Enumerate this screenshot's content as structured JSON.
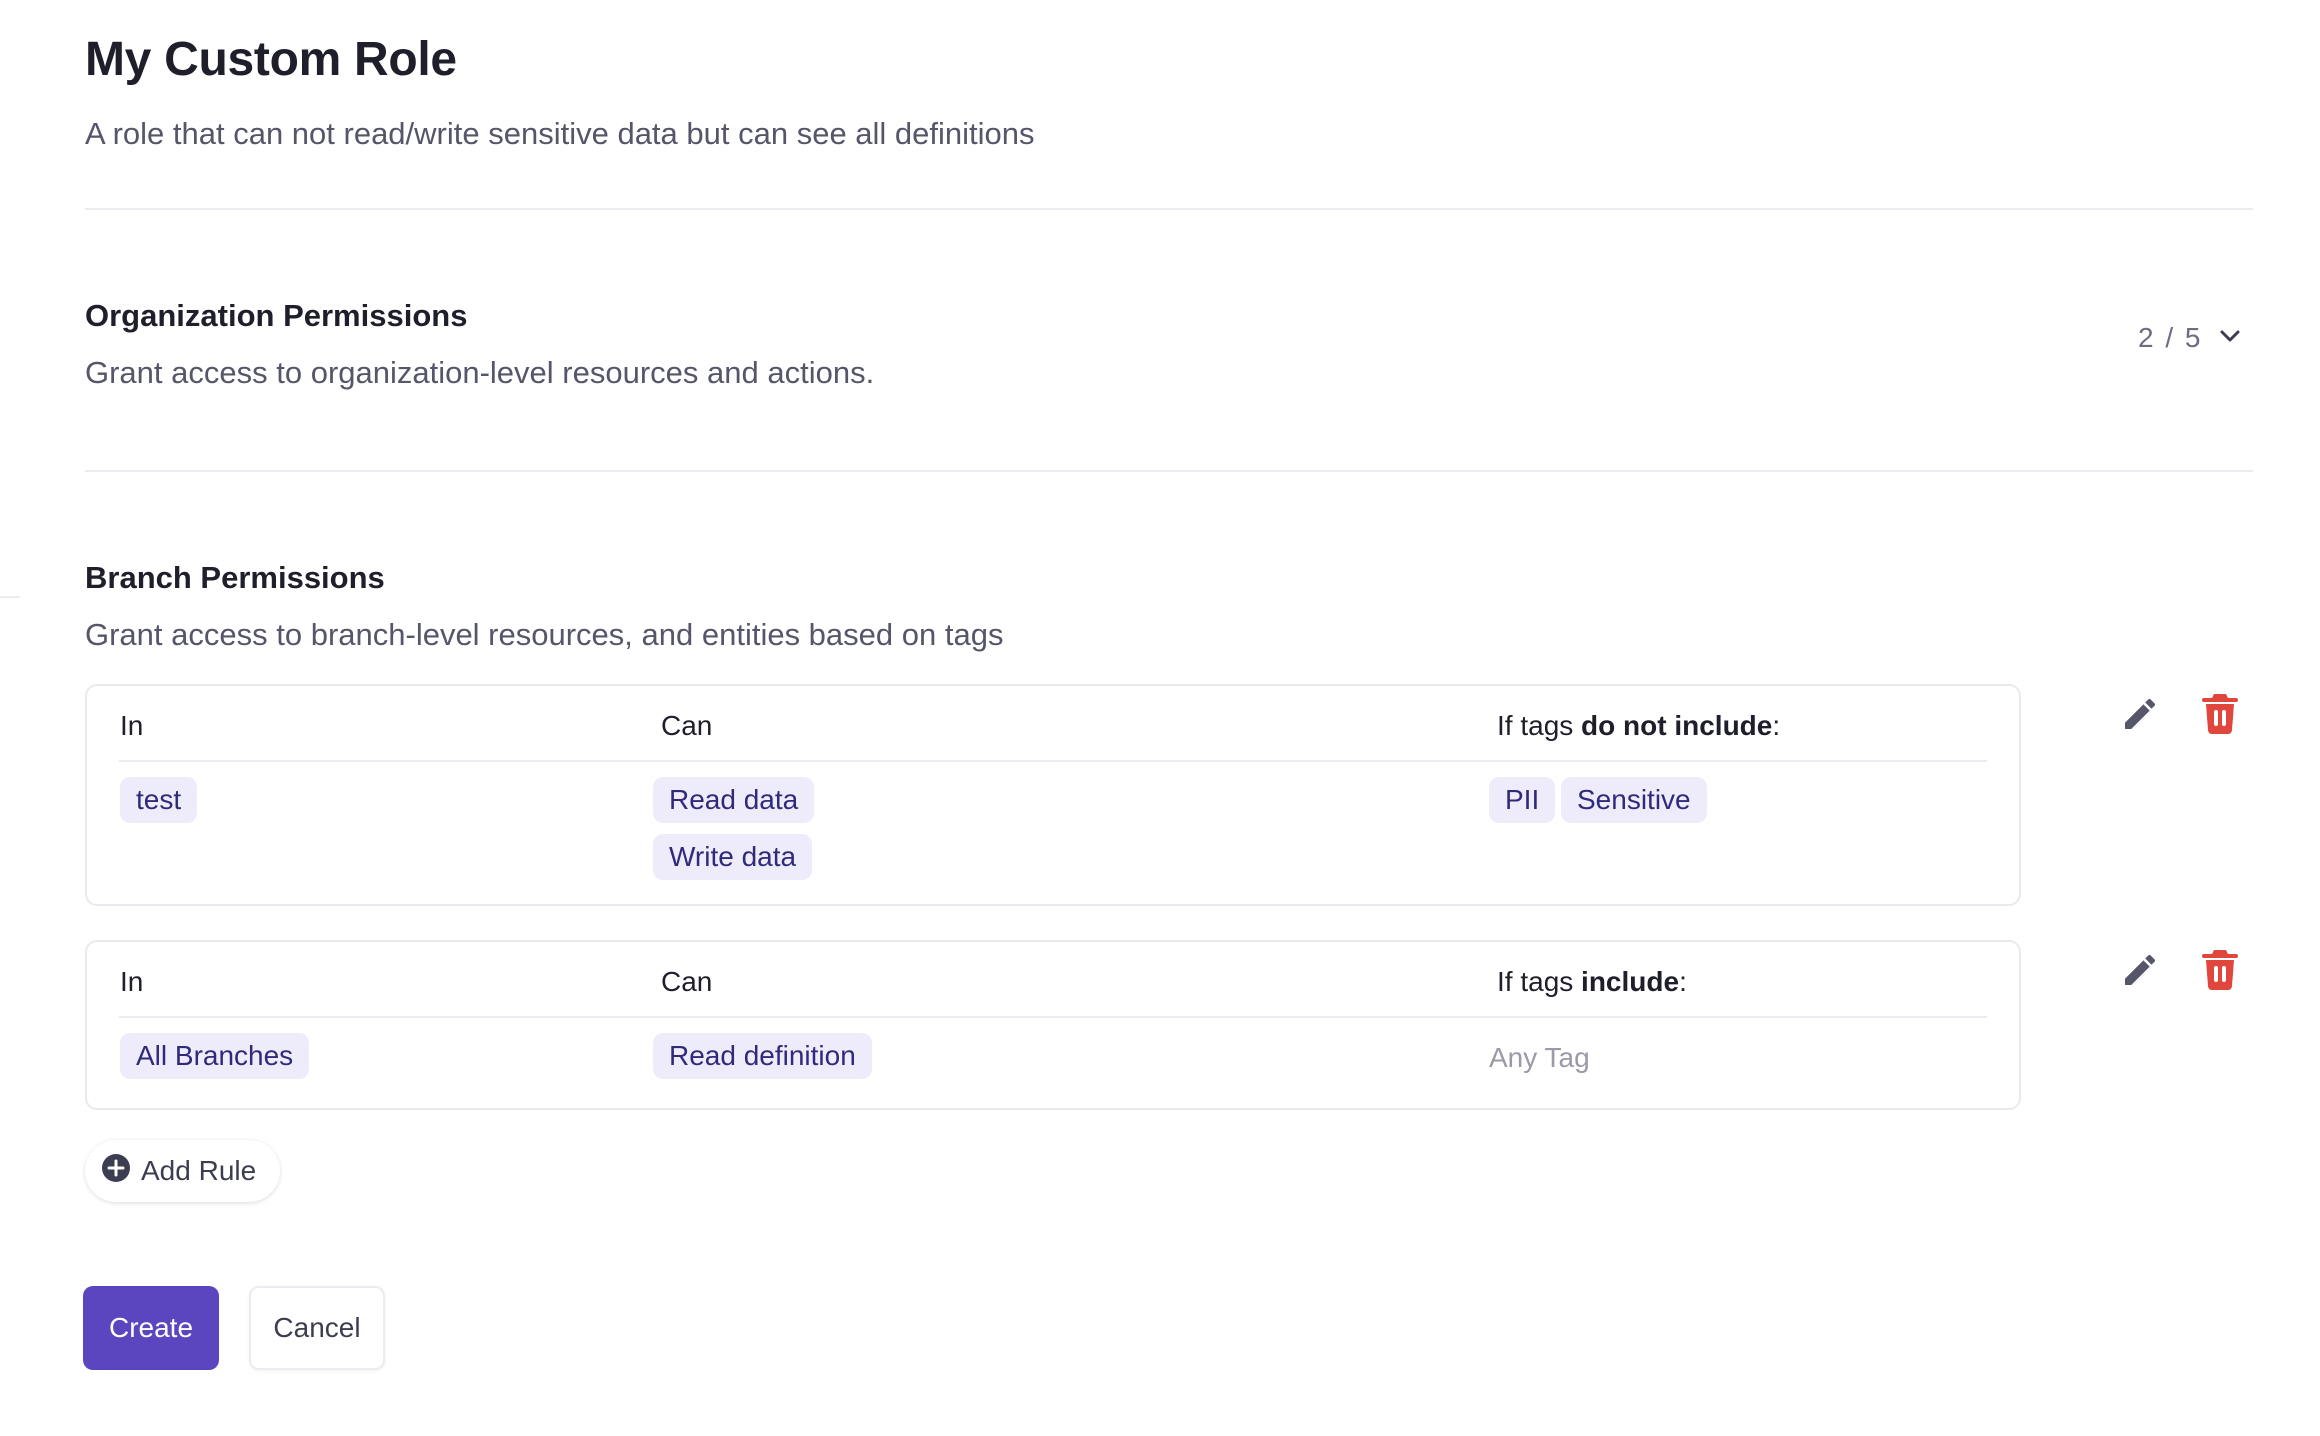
{
  "role": {
    "title": "My Custom Role",
    "description": "A role that can not read/write sensitive data but can see all definitions"
  },
  "org_permissions": {
    "title": "Organization Permissions",
    "description": "Grant access to organization-level resources and actions.",
    "count": "2 / 5",
    "toggle_icon": "chevron-down-icon"
  },
  "branch_permissions": {
    "title": "Branch Permissions",
    "description": "Grant access to branch-level resources, and entities based on tags",
    "columns": {
      "in": "In",
      "can": "Can"
    },
    "rules": [
      {
        "tags_prefix": "If tags ",
        "tags_condition": "do not include",
        "tags_suffix": ":",
        "in_chips": [
          "test"
        ],
        "can_chips": [
          "Read data",
          "Write data"
        ],
        "tag_chips": [
          "PII",
          "Sensitive"
        ]
      },
      {
        "tags_prefix": "If tags ",
        "tags_condition": "include",
        "tags_suffix": ":",
        "in_chips": [
          "All Branches"
        ],
        "can_chips": [
          "Read definition"
        ],
        "tag_placeholder": "Any Tag"
      }
    ],
    "add_rule_label": "Add Rule"
  },
  "actions": {
    "create_label": "Create",
    "cancel_label": "Cancel"
  },
  "icons": {
    "edit": "pencil-icon",
    "delete": "trash-icon",
    "add": "plus-circle-icon"
  },
  "colors": {
    "primary": "#5b46bf",
    "chip_bg": "#eeecfb",
    "chip_text": "#2f2a7a",
    "delete": "#e0463c",
    "edit": "#55566a"
  }
}
